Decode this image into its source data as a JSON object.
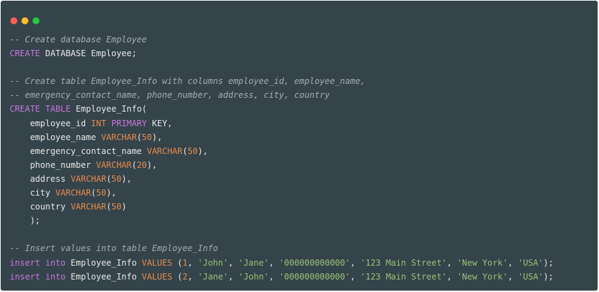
{
  "window": {
    "traffic_lights": [
      {
        "name": "close",
        "color": "#ff5f56"
      },
      {
        "name": "minimize",
        "color": "#ffbd2e"
      },
      {
        "name": "maximize",
        "color": "#27c93f"
      }
    ],
    "background_color": "#35434a"
  },
  "colors": {
    "comment": "#a5aeb1",
    "keyword": "#c678dd",
    "type": "#e58d4e",
    "number": "#e58d4e",
    "string": "#98c379",
    "plain": "#e8eaea"
  },
  "code_lines": [
    [
      {
        "t": "comment",
        "v": "-- Create database Employee"
      }
    ],
    [
      {
        "t": "keyword",
        "v": "CREATE"
      },
      {
        "t": "plain",
        "v": " DATABASE Employee;"
      }
    ],
    [],
    [
      {
        "t": "comment",
        "v": "-- Create table Employee_Info with columns employee_id, employee_name,"
      }
    ],
    [
      {
        "t": "comment",
        "v": "-- emergency_contact_name, phone_number, address, city, country"
      }
    ],
    [
      {
        "t": "keyword",
        "v": "CREATE TABLE"
      },
      {
        "t": "plain",
        "v": " Employee_Info("
      }
    ],
    [
      {
        "t": "plain",
        "v": "    employee_id "
      },
      {
        "t": "type",
        "v": "INT"
      },
      {
        "t": "plain",
        "v": " "
      },
      {
        "t": "keyword",
        "v": "PRIMARY"
      },
      {
        "t": "plain",
        "v": " KEY,"
      }
    ],
    [
      {
        "t": "plain",
        "v": "    employee_name "
      },
      {
        "t": "type",
        "v": "VARCHAR"
      },
      {
        "t": "plain",
        "v": "("
      },
      {
        "t": "number",
        "v": "50"
      },
      {
        "t": "plain",
        "v": "),"
      }
    ],
    [
      {
        "t": "plain",
        "v": "    emergency_contact_name "
      },
      {
        "t": "type",
        "v": "VARCHAR"
      },
      {
        "t": "plain",
        "v": "("
      },
      {
        "t": "number",
        "v": "50"
      },
      {
        "t": "plain",
        "v": "),"
      }
    ],
    [
      {
        "t": "plain",
        "v": "    phone_number "
      },
      {
        "t": "type",
        "v": "VARCHAR"
      },
      {
        "t": "plain",
        "v": "("
      },
      {
        "t": "number",
        "v": "20"
      },
      {
        "t": "plain",
        "v": "),"
      }
    ],
    [
      {
        "t": "plain",
        "v": "    address "
      },
      {
        "t": "type",
        "v": "VARCHAR"
      },
      {
        "t": "plain",
        "v": "("
      },
      {
        "t": "number",
        "v": "50"
      },
      {
        "t": "plain",
        "v": "),"
      }
    ],
    [
      {
        "t": "plain",
        "v": "    city "
      },
      {
        "t": "type",
        "v": "VARCHAR"
      },
      {
        "t": "plain",
        "v": "("
      },
      {
        "t": "number",
        "v": "50"
      },
      {
        "t": "plain",
        "v": "),"
      }
    ],
    [
      {
        "t": "plain",
        "v": "    country "
      },
      {
        "t": "type",
        "v": "VARCHAR"
      },
      {
        "t": "plain",
        "v": "("
      },
      {
        "t": "number",
        "v": "50"
      },
      {
        "t": "plain",
        "v": ")"
      }
    ],
    [
      {
        "t": "plain",
        "v": "    );"
      }
    ],
    [],
    [
      {
        "t": "comment",
        "v": "-- Insert values into table Employee_Info"
      }
    ],
    [
      {
        "t": "keyword",
        "v": "insert into"
      },
      {
        "t": "plain",
        "v": " Employee_Info "
      },
      {
        "t": "type",
        "v": "VALUES"
      },
      {
        "t": "plain",
        "v": " ("
      },
      {
        "t": "number",
        "v": "1"
      },
      {
        "t": "plain",
        "v": ", "
      },
      {
        "t": "string",
        "v": "'John'"
      },
      {
        "t": "plain",
        "v": ", "
      },
      {
        "t": "string",
        "v": "'Jane'"
      },
      {
        "t": "plain",
        "v": ", "
      },
      {
        "t": "string",
        "v": "'000000000000'"
      },
      {
        "t": "plain",
        "v": ", "
      },
      {
        "t": "string",
        "v": "'123 Main Street'"
      },
      {
        "t": "plain",
        "v": ", "
      },
      {
        "t": "string",
        "v": "'New York'"
      },
      {
        "t": "plain",
        "v": ", "
      },
      {
        "t": "string",
        "v": "'USA'"
      },
      {
        "t": "plain",
        "v": ");"
      }
    ],
    [
      {
        "t": "keyword",
        "v": "insert into"
      },
      {
        "t": "plain",
        "v": " Employee_Info "
      },
      {
        "t": "type",
        "v": "VALUES"
      },
      {
        "t": "plain",
        "v": " ("
      },
      {
        "t": "number",
        "v": "2"
      },
      {
        "t": "plain",
        "v": ", "
      },
      {
        "t": "string",
        "v": "'Jane'"
      },
      {
        "t": "plain",
        "v": ", "
      },
      {
        "t": "string",
        "v": "'John'"
      },
      {
        "t": "plain",
        "v": ", "
      },
      {
        "t": "string",
        "v": "'000000000000'"
      },
      {
        "t": "plain",
        "v": ", "
      },
      {
        "t": "string",
        "v": "'123 Main Street'"
      },
      {
        "t": "plain",
        "v": ", "
      },
      {
        "t": "string",
        "v": "'New York'"
      },
      {
        "t": "plain",
        "v": ", "
      },
      {
        "t": "string",
        "v": "'USA'"
      },
      {
        "t": "plain",
        "v": ");"
      }
    ]
  ]
}
